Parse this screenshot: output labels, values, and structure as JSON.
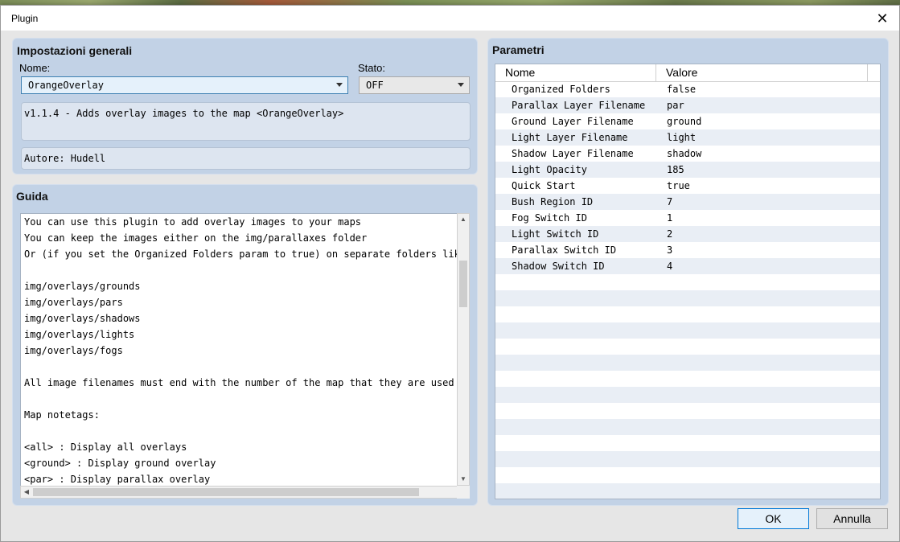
{
  "window": {
    "title": "Plugin",
    "close_glyph": "✕"
  },
  "general": {
    "heading": "Impostazioni generali",
    "name_label": "Nome:",
    "name_value": "OrangeOverlay",
    "status_label": "Stato:",
    "status_value": "OFF",
    "description": "v1.1.4 - Adds overlay images to the map <OrangeOverlay>",
    "author": "Autore: Hudell"
  },
  "guide": {
    "heading": "Guida",
    "lines": [
      "You can use this plugin to add overlay images to your maps",
      "You can keep the images either on the img/parallaxes folder",
      "Or (if you set the Organized Folders param to true) on separate folders like tl",
      "",
      "img/overlays/grounds",
      "img/overlays/pars",
      "img/overlays/shadows",
      "img/overlays/lights",
      "img/overlays/fogs",
      "",
      "All image filenames must end with the number of the map that they are used on",
      "",
      "Map notetags:",
      "",
      "<all> : Display all overlays",
      "<ground> : Display ground overlay",
      "<par> : Display parallax overlay"
    ]
  },
  "params": {
    "heading": "Parametri",
    "col_name": "Nome",
    "col_value": "Valore",
    "rows": [
      {
        "name": "Organized Folders",
        "value": "false"
      },
      {
        "name": "Parallax Layer Filename",
        "value": "par"
      },
      {
        "name": "Ground Layer Filename",
        "value": "ground"
      },
      {
        "name": "Light Layer Filename",
        "value": "light"
      },
      {
        "name": "Shadow Layer Filename",
        "value": "shadow"
      },
      {
        "name": "Light Opacity",
        "value": "185"
      },
      {
        "name": "Quick Start",
        "value": "true"
      },
      {
        "name": "Bush Region ID",
        "value": "7"
      },
      {
        "name": "Fog Switch ID",
        "value": "1"
      },
      {
        "name": "Light Switch ID",
        "value": "2"
      },
      {
        "name": "Parallax Switch ID",
        "value": "3"
      },
      {
        "name": "Shadow Switch ID",
        "value": "4"
      }
    ]
  },
  "buttons": {
    "ok": "OK",
    "cancel": "Annulla"
  }
}
